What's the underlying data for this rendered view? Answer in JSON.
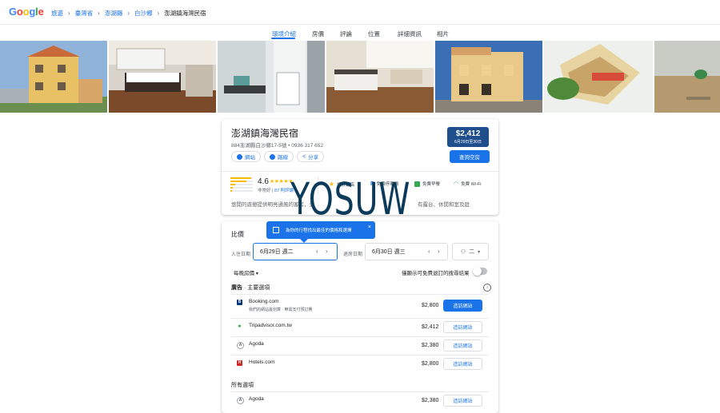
{
  "header": {
    "logo": "Google",
    "logo_colors": [
      "#4285f4",
      "#ea4335",
      "#fbbc04",
      "#4285f4",
      "#34a853",
      "#ea4335"
    ],
    "breadcrumbs": [
      "旅遊",
      "臺灣省",
      "澎湖縣",
      "白沙鄉",
      "澎湖鎮海灣民宿"
    ]
  },
  "tabs": [
    "環境介紹",
    "房價",
    "評論",
    "位置",
    "詳細資訊",
    "相片"
  ],
  "hotel": {
    "name": "澎湖鎮海灣民宿",
    "address": "884澎湖縣白沙鄉17-5號 • 0936 317 652",
    "actions": [
      "網站",
      "路線",
      "分享"
    ],
    "price": "$2,412",
    "price_dates": "6月29日至30日",
    "check_label": "查詢空房",
    "rating": "4.6",
    "stars": "★★★★★",
    "rating_label": "非常好",
    "reviews": "87 則評論",
    "amenities": [
      "評分最高",
      "免費停車場",
      "免費早餐",
      "免費 Wi-Fi"
    ],
    "description": "悠閒的遊憩提供明亮通風的客房，並",
    "description_tail": "有露台、休閒和室及庭"
  },
  "watermark": "YOSUW",
  "compare": {
    "title": "比價",
    "tooltip": "為你的行程找出最佳的價格和選擇",
    "checkin_label": "入住日期",
    "checkin": "6月29日 週二",
    "checkout_label": "退房日期",
    "checkout": "6月30日 週三",
    "guests": "二",
    "nightly": "每晚房價",
    "free_cancel": "僅顯示可免費退訂的搜尋結果",
    "ads_label": "廣告",
    "featured_title": "主要選項",
    "all_title": "所有選項",
    "visit": "造訪網站",
    "featured": [
      {
        "name": "Booking.com",
        "sub": "我們的網站最划算 · 無需支付預訂費",
        "price": "$2,800",
        "color": "#003580",
        "mark": "B"
      },
      {
        "name": "Tripadvisor.com.tw",
        "sub": "",
        "price": "$2,412",
        "color": "#34a853",
        "mark": "●"
      },
      {
        "name": "Agoda",
        "sub": "",
        "price": "$2,380",
        "color": "#5f6368",
        "mark": "A"
      },
      {
        "name": "Hotels.com",
        "sub": "",
        "price": "$2,800",
        "color": "#d32323",
        "mark": "H"
      }
    ],
    "all": [
      {
        "name": "Agoda",
        "price": "$2,380",
        "color": "#5f6368",
        "mark": "A"
      }
    ]
  }
}
